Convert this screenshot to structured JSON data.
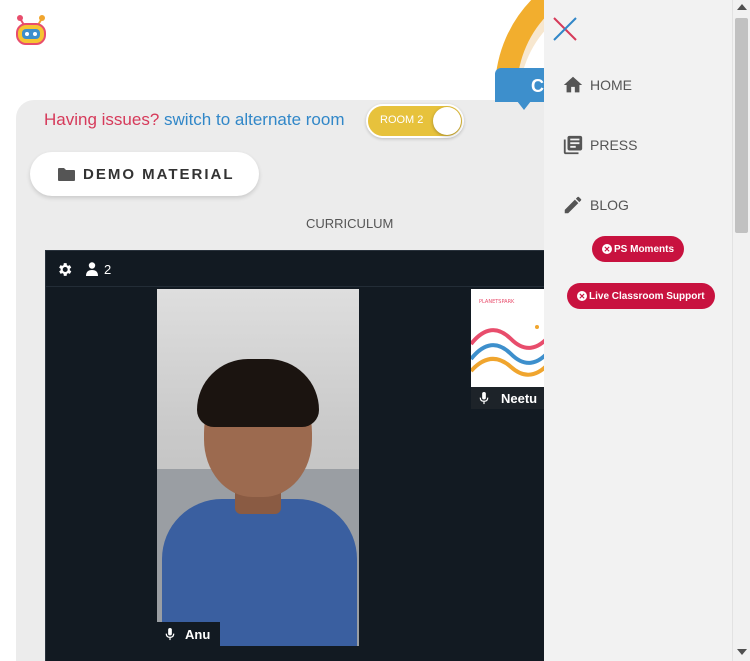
{
  "issues": {
    "prefix": "Having issues?",
    "link": "switch to alternate room"
  },
  "room_toggle": {
    "label": "ROOM 2"
  },
  "demo_material": {
    "label": "DEMO MATERIAL"
  },
  "curriculum": {
    "label": "CURRICULUM"
  },
  "blue_tab": {
    "label": "C"
  },
  "video": {
    "participant_count": "2",
    "main_participant": "Anu",
    "side_participant": "Neetu"
  },
  "menu": {
    "items": [
      {
        "label": "HOME",
        "icon": "home-icon"
      },
      {
        "label": "PRESS",
        "icon": "press-icon"
      },
      {
        "label": "BLOG",
        "icon": "pencil-icon"
      }
    ],
    "pills": [
      {
        "label": "PS Moments"
      },
      {
        "label": "Live Classroom Support"
      }
    ]
  },
  "colors": {
    "accent_red": "#d63a5a",
    "accent_blue": "#3187c8",
    "toggle_yellow": "#e7c23c",
    "pill_red": "#c8123f",
    "arc_orange": "#f2ae2e"
  }
}
